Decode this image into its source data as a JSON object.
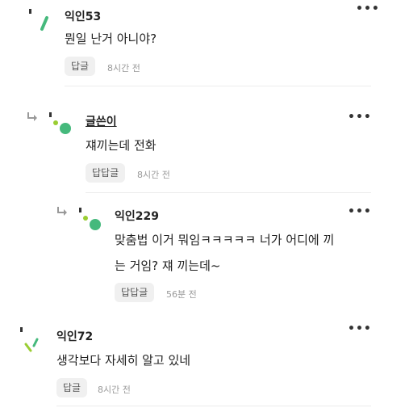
{
  "comments": [
    {
      "author": "익인53",
      "text": "뭔일 난거 아니야?",
      "reply_label": "답글",
      "time": "8시간 전",
      "more": "•••",
      "avatar_icon": "slash-avatar-icon"
    },
    {
      "author": "글쓴이",
      "text": "쟤끼는데 전화",
      "reply_label": "답답글",
      "time": "8시간 전",
      "more": "•••",
      "avatar_icon": "green-dot-avatar-icon"
    },
    {
      "author": "익인229",
      "text_line1": "맞춤법 이거 뭐임ㅋㅋㅋㅋㅋ 너가 어디에 끼",
      "text_line2": "는 거임? 쟤 끼는데~",
      "reply_label": "답답글",
      "time": "56분 전",
      "more": "•••",
      "avatar_icon": "green-dot-avatar-icon"
    },
    {
      "author": "익인72",
      "text": "생각보다 자세히 알고 있네",
      "reply_label": "답글",
      "time": "8시간 전",
      "more": "•••",
      "avatar_icon": "double-slash-avatar-icon"
    }
  ],
  "colors": {
    "green": "#45b97c",
    "lime": "#9acd32",
    "reply_bg": "#f0f0f0"
  }
}
